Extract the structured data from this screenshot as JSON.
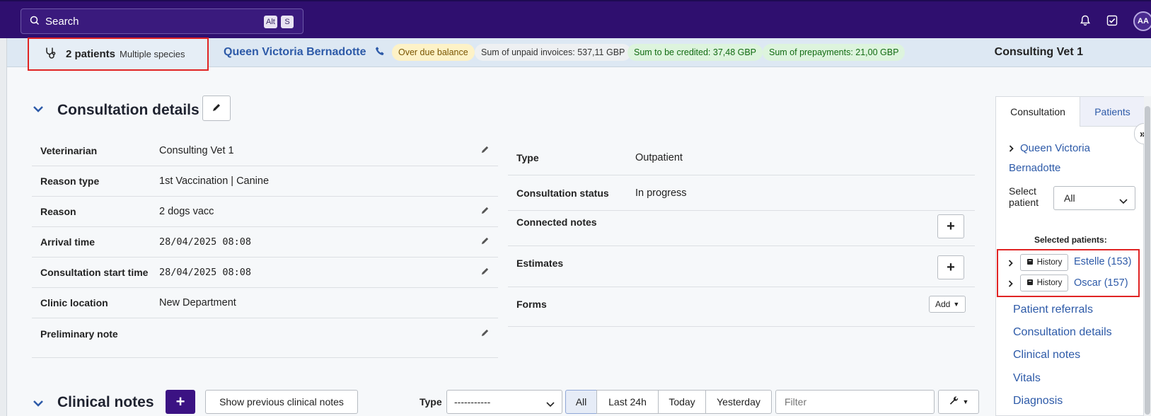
{
  "search": {
    "label": "Search",
    "kbd": [
      "Alt",
      "S"
    ]
  },
  "topbar": {
    "avatar_initials": "AA"
  },
  "patientbar": {
    "patients_count": "2 patients",
    "species": "Multiple species",
    "owner": "Queen Victoria Bernadotte",
    "badges": [
      {
        "text": "Over due balance",
        "tone": "warning"
      },
      {
        "text": "Sum of unpaid invoices: 537,11 GBP",
        "tone": "neutral"
      },
      {
        "text": "Sum to be credited: 37,48 GBP",
        "tone": "success"
      },
      {
        "text": "Sum of prepayments: 21,00 GBP",
        "tone": "success"
      }
    ],
    "vet": "Consulting Vet 1"
  },
  "consultation": {
    "title": "Consultation details",
    "left_rows": [
      {
        "label": "Veterinarian",
        "value": "Consulting Vet 1"
      },
      {
        "label": "Reason type",
        "value": "1st Vaccination | Canine"
      },
      {
        "label": "Reason",
        "value": "2 dogs vacc"
      },
      {
        "label": "Arrival time",
        "value": "28/04/2025 08:08"
      },
      {
        "label": "Consultation start time",
        "value": "28/04/2025 08:08"
      },
      {
        "label": "Clinic location",
        "value": "New Department"
      },
      {
        "label": "Preliminary note",
        "value": ""
      }
    ],
    "right_rows": [
      {
        "label": "Type",
        "value": "Outpatient"
      },
      {
        "label": "Consultation status",
        "value": "In progress"
      },
      {
        "label": "Connected notes"
      },
      {
        "label": "Estimates"
      },
      {
        "label": "Forms",
        "action": "Add"
      }
    ]
  },
  "clinical_notes": {
    "title": "Clinical notes",
    "show_previous": "Show previous clinical notes",
    "type_label": "Type",
    "type_value": "-----------",
    "ranges": [
      "All",
      "Last 24h",
      "Today",
      "Yesterday"
    ],
    "active_range": "All",
    "filter_placeholder": "Filter"
  },
  "right_panel": {
    "tabs": [
      "Consultation",
      "Patients"
    ],
    "owner_line1": "Queen Victoria",
    "owner_line2": "Bernadotte",
    "select_label_1": "Select",
    "select_label_2": "patient",
    "select_value": "All",
    "selected_title": "Selected patients:",
    "patients": [
      {
        "history": "History",
        "name": "Estelle (153)"
      },
      {
        "history": "History",
        "name": "Oscar (157)"
      }
    ],
    "nav": [
      "Patient referrals",
      "Consultation details",
      "Clinical notes",
      "Vitals",
      "Diagnosis"
    ]
  }
}
